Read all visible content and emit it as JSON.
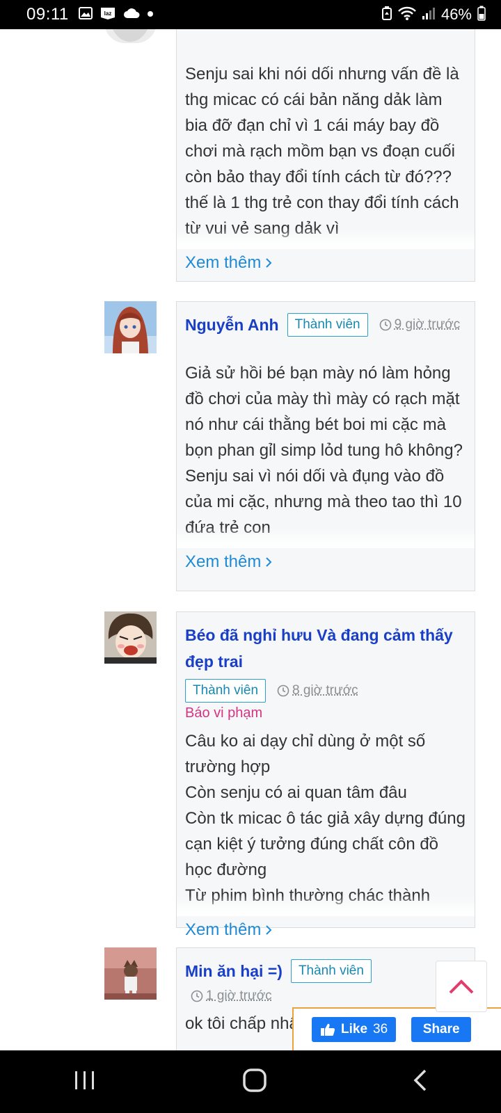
{
  "status_bar": {
    "time": "09:11",
    "battery_percent": "46%",
    "left_icons": [
      "image-icon",
      "laz-icon",
      "cloud-icon",
      "dot-icon"
    ],
    "right_icons": [
      "battery-saver-icon",
      "wifi-icon",
      "signal-icon",
      "battery-icon"
    ]
  },
  "comments": [
    {
      "author": "",
      "body": [
        "Senju sai khi nói dối nhưng vấn đề là thg micac có cái bản năng dảk làm bia đỡ đạn chỉ vì 1 cái máy bay đồ chơi mà rạch mồm bạn vs đoạn cuối còn bảo thay đổi tính cách từ đó??? thế là 1 thg trẻ con thay đổi tính cách từ vui vẻ sang dảk vì"
      ],
      "see_more": "Xem thêm"
    },
    {
      "author": "Nguyễn Anh",
      "badge": "Thành viên",
      "time": "9 giờ trước",
      "body": [
        "Giả sử hồi bé bạn mày nó làm hỏng đồ chơi của mày thì mày có rạch mặt nó như cái thằng bét boi mi cặc mà bọn phan gỉl simp lỏd tung hô không? Senju sai vì nói dối và đụng vào đồ của mi cặc, nhưng mà theo tao thì 10 đứa trẻ con"
      ],
      "see_more": "Xem thêm"
    },
    {
      "author": "Béo đã nghỉ hưu Và đang cảm thấy đẹp trai",
      "badge": "Thành viên",
      "time": "8 giờ trước",
      "report": "Báo vi phạm",
      "body": [
        "Câu ko ai dạy chỉ dùng ở một số trường hợp",
        "Còn senju có ai quan tâm đâu",
        "Còn tk micac ô tác giả xây dựng đúng cạn kiệt ý tưởng đúng chất côn đồ học đường",
        "Từ phim bình thường chác thành"
      ],
      "see_more": "Xem thêm"
    },
    {
      "author": "Min ăn hại =)",
      "badge": "Thành viên",
      "time": "1 giờ trước",
      "body": [
        "ok tôi chấp nhận"
      ]
    }
  ],
  "fb": {
    "like_label": "Like",
    "like_count": "36",
    "share_label": "Share"
  },
  "colors": {
    "author": "#1a3fc7",
    "badge": "#2aa1c9",
    "link": "#1f8ad6",
    "report": "#d63384",
    "fb_blue": "#1877f2",
    "scroll_top_arrow": "#e23c6c"
  }
}
